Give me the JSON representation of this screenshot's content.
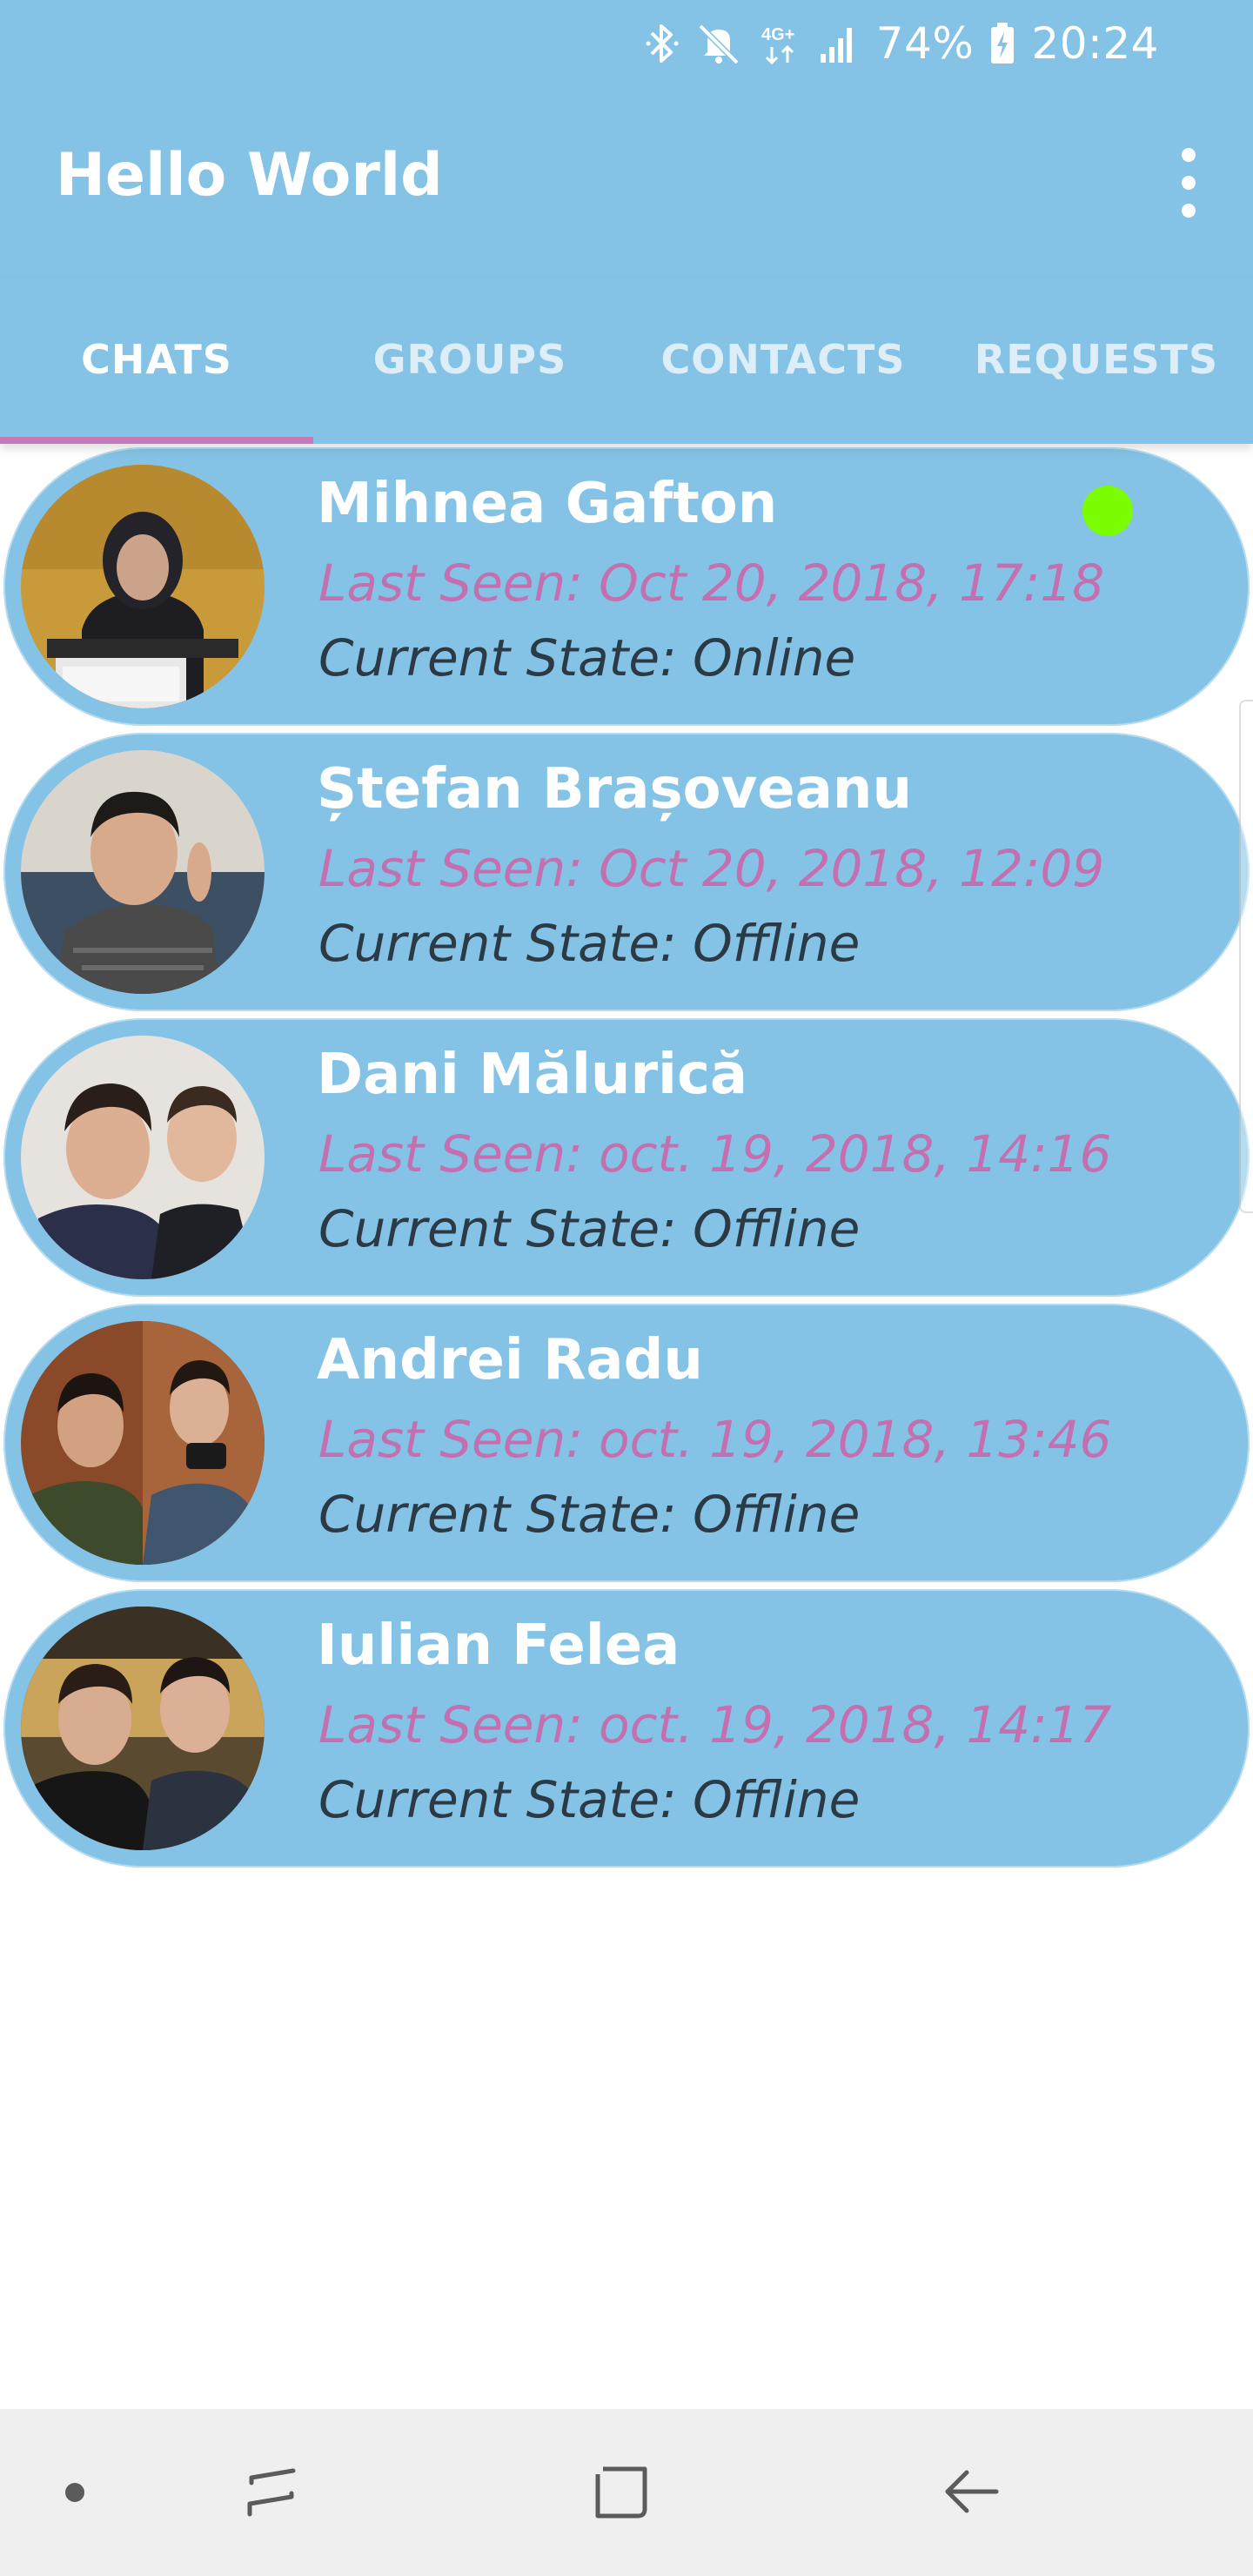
{
  "status_bar": {
    "battery": "74%",
    "time": "20:24",
    "network": "4G+",
    "icons": [
      "bluetooth-icon",
      "mute-icon",
      "network-4g-icon",
      "signal-icon",
      "battery-charging-icon"
    ]
  },
  "app_bar": {
    "title": "Hello World",
    "menu_icon": "more-vert-icon"
  },
  "tabs": [
    {
      "label": "CHATS",
      "active": true
    },
    {
      "label": "GROUPS",
      "active": false
    },
    {
      "label": "CONTACTS",
      "active": false
    },
    {
      "label": "REQUESTS",
      "active": false
    }
  ],
  "chats": [
    {
      "name": "Mihnea Gafton",
      "last_seen": "Last Seen: Oct 20, 2018, 17:18",
      "state": "Current State: Online",
      "online": true
    },
    {
      "name": "Ștefan Brașoveanu",
      "last_seen": "Last Seen: Oct 20, 2018, 12:09",
      "state": "Current State: Offline",
      "online": false
    },
    {
      "name": "Dani Mălurică",
      "last_seen": "Last Seen: oct. 19, 2018, 14:16",
      "state": "Current State: Offline",
      "online": false
    },
    {
      "name": "Andrei Radu",
      "last_seen": "Last Seen: oct. 19, 2018, 13:46",
      "state": "Current State: Offline",
      "online": false
    },
    {
      "name": "Iulian Felea",
      "last_seen": "Last Seen: oct. 19, 2018, 14:17",
      "state": "Current State: Offline",
      "online": false
    }
  ],
  "colors": {
    "primary": "#84c3e5",
    "accent": "#c877b8",
    "last_seen_text": "#c46fb0",
    "state_text": "#2b3a45",
    "online_indicator": "#7cfc00"
  },
  "nav_bar": {
    "buttons": [
      "nav-dot-icon",
      "recents-icon",
      "home-icon",
      "back-icon"
    ]
  }
}
